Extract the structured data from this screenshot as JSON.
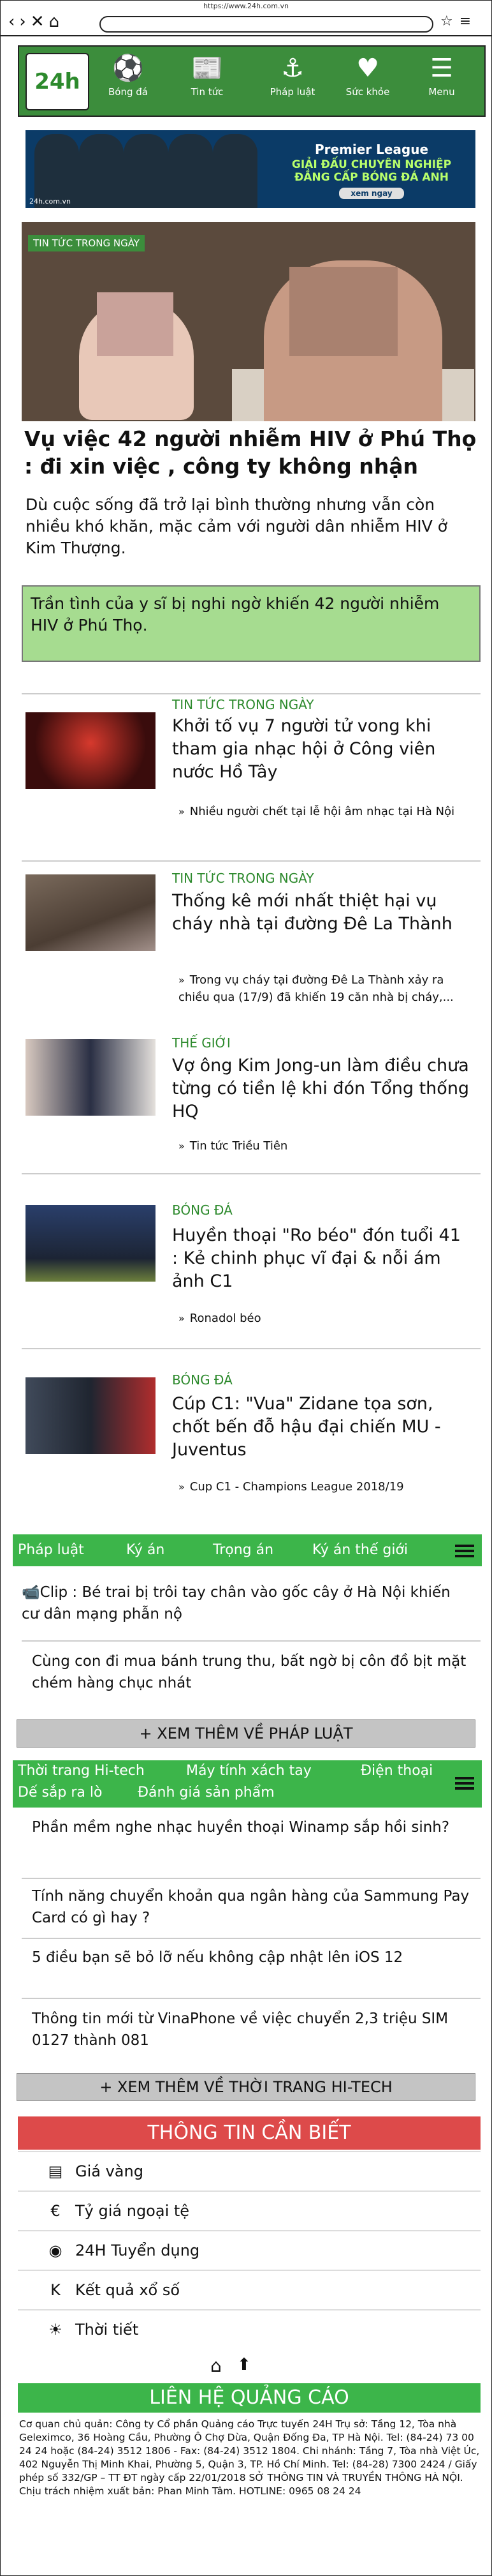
{
  "browser": {
    "url": "https://www.24h.com.vn",
    "nav_glyphs": "‹›✕⌂",
    "icons": "☆≡"
  },
  "topnav": {
    "logo": "24h",
    "items": [
      {
        "label": "Bóng đá",
        "icon": "soccer-ball-icon",
        "glyph": "⚽"
      },
      {
        "label": "Tin tức",
        "icon": "newspaper-icon",
        "glyph": "📰"
      },
      {
        "label": "Pháp luật",
        "icon": "anchor-icon",
        "glyph": "⚓"
      },
      {
        "label": "Sức khỏe",
        "icon": "heart-icon",
        "glyph": "♥"
      },
      {
        "label": "Menu",
        "icon": "menu-icon",
        "glyph": "☰"
      }
    ]
  },
  "banner": {
    "line1": "Premier League",
    "line2": "GIẢI ĐẤU CHUYÊN NGHIỆP",
    "line3": "ĐẲNG CẤP BÓNG ĐÁ ANH",
    "button": "xem ngay",
    "site": "24h.com.vn"
  },
  "hero": {
    "tag": "TIN TỨC TRONG NGÀY",
    "title": "Vụ việc 42 người nhiễm HIV ở Phú Thọ : đi xin việc , công ty không nhận",
    "lead": "Dù cuộc sống đã trở lại bình thường nhưng vẫn còn nhiều khó khăn, mặc cảm với người dân nhiễm HIV ở Kim Thượng.",
    "quote": "Trần tình của y sĩ bị nghi ngờ khiến 42 người nhiễm HIV ở Phú Thọ."
  },
  "articles": [
    {
      "category": "TIN TỨC TRONG NGÀY",
      "title": "Khởi tố vụ 7 người tử vong khi tham gia nhạc hội ở Công viên nước Hồ Tây",
      "related": "Nhiều người chết tại lễ hội âm nhạc tại Hà Nội"
    },
    {
      "category": "TIN TỨC TRONG NGÀY",
      "title": "Thống kê mới nhất thiệt hại vụ cháy nhà tại đường Đê La Thành",
      "related": "Trong vụ cháy tại đường Đê La Thành xảy ra chiều qua (17/9) đã khiến 19 căn nhà bị cháy,..."
    },
    {
      "category": "THẾ GIỚI",
      "title": "Vợ ông Kim Jong-un làm điều chưa từng có tiền lệ khi đón Tổng thống HQ",
      "related": "Tin tức Triều Tiên"
    },
    {
      "category": "BÓNG ĐÁ",
      "title": "Huyền thoại \"Ro béo\" đón tuổi 41 : Kẻ chinh phục vĩ đại & nỗi ám ảnh C1",
      "related": "Ronadol béo"
    },
    {
      "category": "BÓNG ĐÁ",
      "title": "Cúp C1: \"Vua\" Zidane tọa sơn, chốt bến đỗ hậu đại chiến MU - Juventus",
      "related": "Cup C1 - Champions League 2018/19"
    }
  ],
  "law": {
    "tabs": [
      "Pháp luật",
      "Ký án",
      "Trọng án",
      "Ký án thế giới"
    ],
    "items": [
      "Clip : Bé trai bị trôi tay chân vào gốc cây ở Hà Nội khiến cư dân mạng phẫn nộ",
      "Cùng con đi mua bánh trung thu, bất ngờ bị côn đồ bịt mặt chém hàng chục nhát"
    ],
    "more": "+ XEM THÊM VỀ PHÁP LUẬT"
  },
  "tech": {
    "tabs": [
      "Thời trang Hi-tech",
      "Máy tính xách tay",
      "Điện thoại",
      "Dế sắp ra lò",
      "Đánh giá sản phẩm"
    ],
    "items": [
      "Phần mềm nghe nhạc huyền thoại Winamp sắp hồi sinh?",
      "Tính năng chuyển khoản qua ngân hàng của Sammung Pay Card có gì hay ?",
      "5 điều bạn sẽ bỏ lỡ nếu không cập nhật lên iOS 12",
      "Thông tin mới từ VinaPhone về việc chuyển 2,3 triệu SIM 0127 thành 081"
    ],
    "more": "+ XEM THÊM VỀ THỜI TRANG HI-TECH"
  },
  "info": {
    "title": "THÔNG TIN CẦN BIẾT",
    "tools": [
      {
        "label": "Giá vàng",
        "icon": "gold-icon",
        "glyph": "▤"
      },
      {
        "label": "Tỷ giá ngoại tệ",
        "icon": "currency-icon",
        "glyph": "€"
      },
      {
        "label": "24H Tuyển dụng",
        "icon": "recruitment-icon",
        "glyph": "◉"
      },
      {
        "label": "Kết quả xổ số",
        "icon": "lottery-icon",
        "glyph": "K"
      },
      {
        "label": "Thời tiết",
        "icon": "weather-icon",
        "glyph": "☀"
      }
    ],
    "bottom_icons": [
      "home-icon",
      "arrow-up-icon"
    ],
    "bottom_glyphs": [
      "⌂",
      "⬆"
    ]
  },
  "contact": {
    "title": "LIÊN HỆ QUẢNG CÁO",
    "footer": "Cơ quan chủ quản: Công ty Cổ phần Quảng cáo Trực tuyến 24H Trụ sở: Tầng 12, Tòa nhà Geleximco, 36 Hoàng Cầu, Phường Ô Chợ Dừa, Quận Đống Đa, TP Hà Nội. Tel: (84-24) 73 00 24 24 hoặc (84-24) 3512 1806 - Fax: (84-24) 3512 1804. Chi nhánh: Tầng 7, Tòa nhà Việt Úc, 402 Nguyễn Thị Minh Khai, Phường 5, Quận 3, TP. Hồ Chí Minh. Tel: (84-28) 7300 2424 / Giấy phép số 332/GP – TT ĐT ngày cấp 22/01/2018 SỞ THÔNG TIN VÀ TRUYỀN THÔNG HÀ NỘI. Chịu trách nhiệm xuất bản: Phan Minh Tâm. HOTLINE: 0965 08 24 24"
  }
}
